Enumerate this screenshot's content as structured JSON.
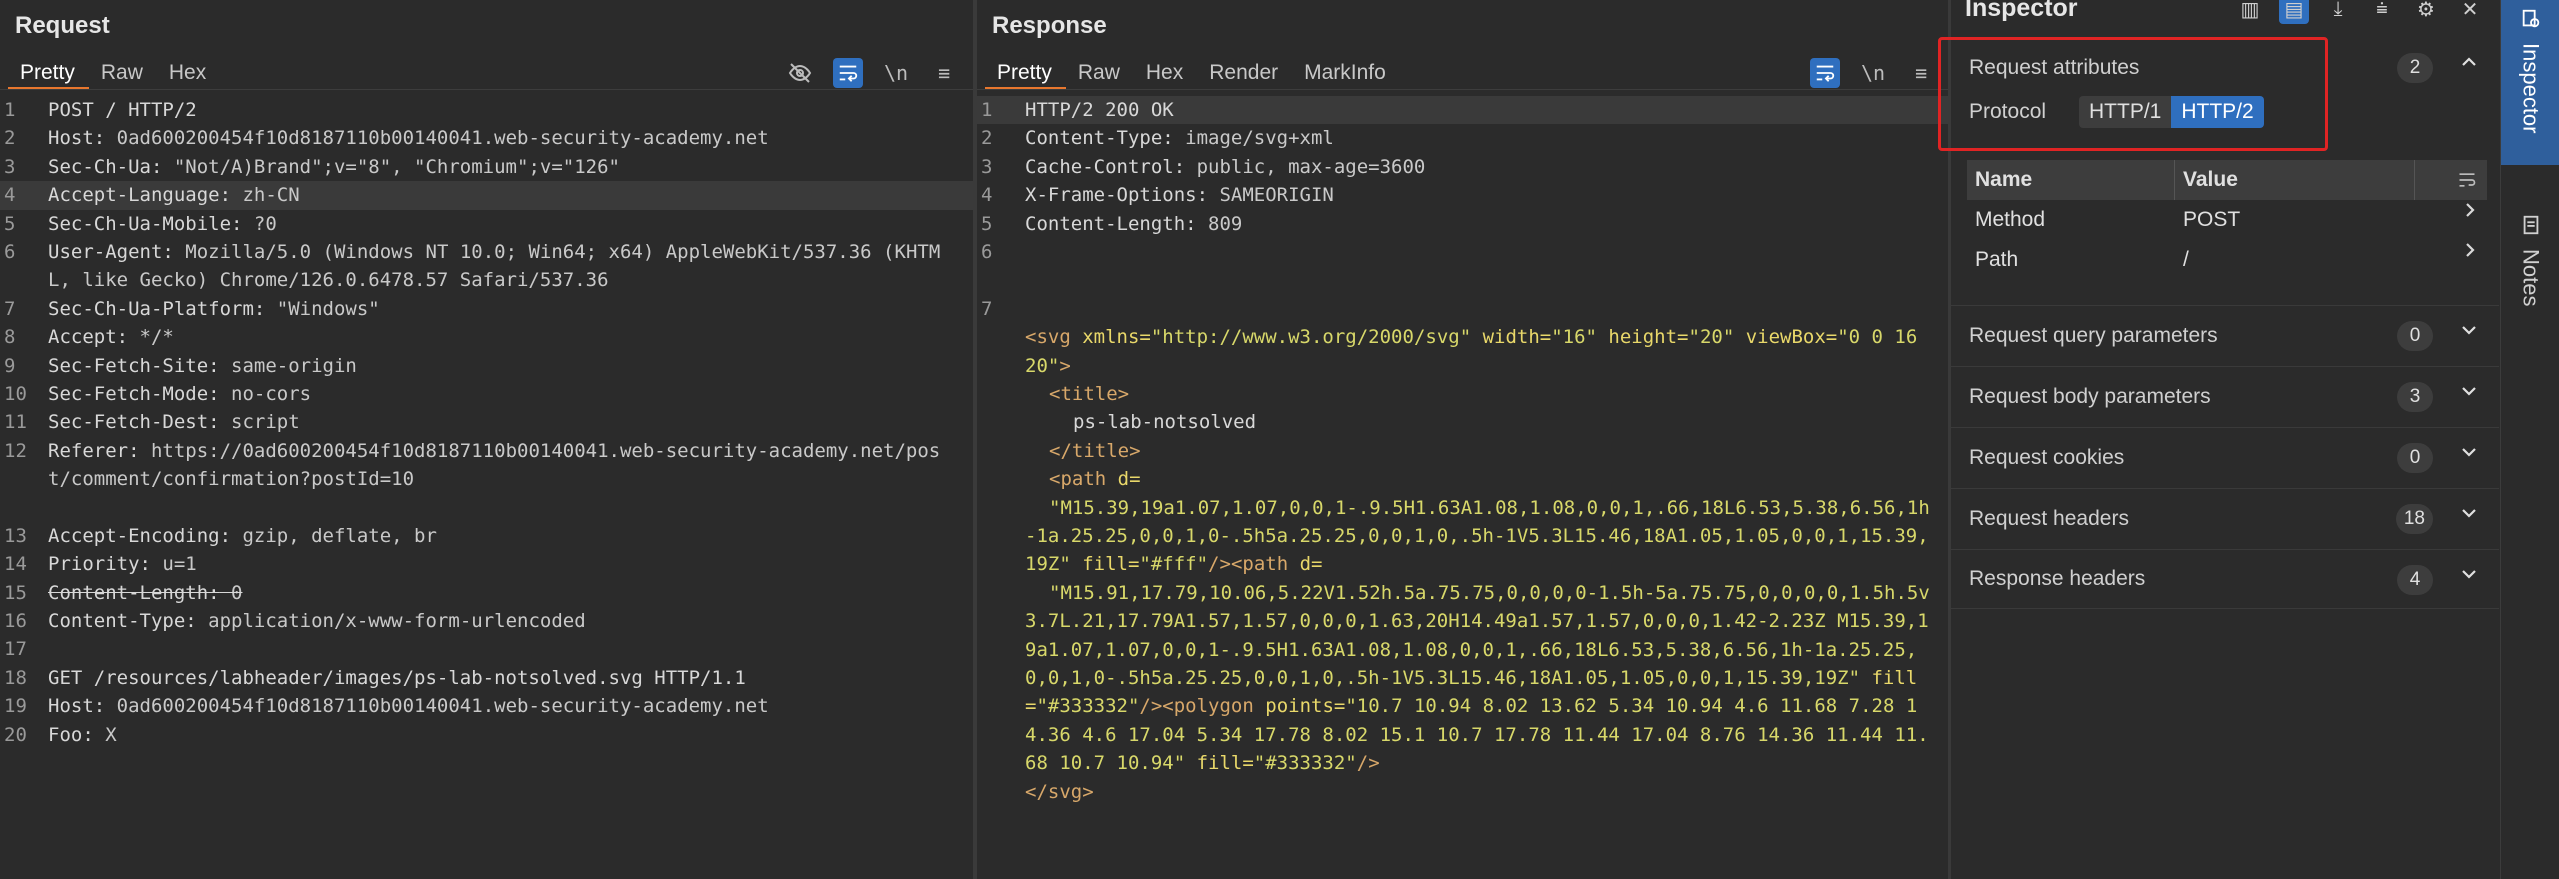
{
  "request": {
    "title": "Request",
    "tabs": [
      "Pretty",
      "Raw",
      "Hex"
    ],
    "active_tab": "Pretty",
    "tools": {
      "hide": "⊘",
      "wrap": "↵",
      "newline": "\\n",
      "menu": "≡"
    },
    "lines": [
      {
        "n": "1",
        "key": "POST / HTTP/2",
        "val": ""
      },
      {
        "n": "2",
        "key": "Host:",
        "val": " 0ad600200454f10d8187110b00140041.web-security-academy.net"
      },
      {
        "n": "3",
        "key": "Sec-Ch-Ua:",
        "val": " \"Not/A)Brand\";v=\"8\", \"Chromium\";v=\"126\""
      },
      {
        "n": "4",
        "key": "Accept-Language:",
        "val": " zh-CN"
      },
      {
        "n": "5",
        "key": "Sec-Ch-Ua-Mobile:",
        "val": " ?0"
      },
      {
        "n": "6",
        "key": "User-Agent:",
        "val": " Mozilla/5.0 (Windows NT 10.0; Win64; x64) AppleWebKit/537.36 (KHTML, like Gecko) Chrome/126.0.6478.57 Safari/537.36"
      },
      {
        "n": "7",
        "key": "Sec-Ch-Ua-Platform:",
        "val": " \"Windows\""
      },
      {
        "n": "8",
        "key": "Accept:",
        "val": " */*"
      },
      {
        "n": "9",
        "key": "Sec-Fetch-Site:",
        "val": " same-origin"
      },
      {
        "n": "10",
        "key": "Sec-Fetch-Mode:",
        "val": " no-cors"
      },
      {
        "n": "11",
        "key": "Sec-Fetch-Dest:",
        "val": " script"
      },
      {
        "n": "12",
        "key": "Referer:",
        "val": " https://0ad600200454f10d8187110b00140041.web-security-academy.net/post/comment/confirmation?postId=10"
      },
      {
        "n": "13",
        "key": "Accept-Encoding:",
        "val": " gzip, deflate, br"
      },
      {
        "n": "14",
        "key": "Priority:",
        "val": " u=1"
      },
      {
        "n": "15",
        "key": "Content-Length:",
        "val": " 0"
      },
      {
        "n": "16",
        "key": "Content-Type:",
        "val": " application/x-www-form-urlencoded"
      },
      {
        "n": "17",
        "key": "",
        "val": ""
      },
      {
        "n": "18",
        "key": "GET /resources/labheader/images/ps-lab-notsolved.svg HTTP/1.1",
        "val": ""
      },
      {
        "n": "19",
        "key": "Host:",
        "val": " 0ad600200454f10d8187110b00140041.web-security-academy.net"
      },
      {
        "n": "20",
        "key": "Foo:",
        "val": " X"
      }
    ]
  },
  "response": {
    "title": "Response",
    "tabs": [
      "Pretty",
      "Raw",
      "Hex",
      "Render",
      "MarkInfo"
    ],
    "active_tab": "Pretty",
    "tools": {
      "wrap": "↵",
      "newline": "\\n",
      "menu": "≡"
    },
    "header_lines": [
      {
        "n": "1",
        "text": "HTTP/2 200 OK"
      },
      {
        "n": "2",
        "key": "Content-Type:",
        "val": " image/svg+xml"
      },
      {
        "n": "3",
        "key": "Cache-Control:",
        "val": " public, max-age=3600"
      },
      {
        "n": "4",
        "key": "X-Frame-Options:",
        "val": " SAMEORIGIN"
      },
      {
        "n": "5",
        "key": "Content-Length:",
        "val": " 809"
      },
      {
        "n": "6",
        "text": ""
      }
    ],
    "body": {
      "n7": "7",
      "svg_open": "<svg",
      "xmlns_attr": " xmlns=",
      "xmlns_val": "\"http://www.w3.org/2000/svg\"",
      "width_attr": " width=",
      "width_val": "\"16\"",
      "height_attr": " height=",
      "height_val": "\"20\"",
      "viewbox_attr": " viewBox=",
      "viewbox_val": "\"0 0 16 20\"",
      "gt": ">",
      "title_open": "<title>",
      "title_text": "ps-lab-notsolved",
      "title_close": "</title>",
      "path1_open": "<path",
      "d_attr": " d=",
      "path1_d": "\"M15.39,19a1.07,1.07,0,0,1-.9.5H1.63A1.08,1.08,0,0,1,.66,18L6.53,5.38,6.56,1h-1a.25.25,0,0,1,0-.5h5a.25.25,0,0,1,0,.5h-1V5.3L15.46,18A1.05,1.05,0,0,1,15.39,19Z\"",
      "fill_attr": " fill=",
      "fill1_val": "\"#fff\"",
      "selfclose": "/>",
      "path2_open": "<path",
      "path2_d": "\"M15.91,17.79,10.06,5.22V1.52h.5a.75.75,0,0,0,0-1.5h-5a.75.75,0,0,0,0,1.5h.5v3.7L.21,17.79A1.57,1.57,0,0,0,1.63,20H14.49a1.57,1.57,0,0,0,1.42-2.23Z M15.39,19a1.07,1.07,0,0,1-.9.5H1.63A1.08,1.08,0,0,1,.66,18L6.53,5.38,6.56,1h-1a.25.25,0,0,1,0-.5h5a.25.25,0,0,1,0,.5h-1V5.3L15.46,18A1.05,1.05,0,0,1,15.39,19Z\"",
      "fill2_val": "\"#333332\"",
      "polygon_open": "<polygon",
      "points_attr": " points=",
      "points_val": "\"10.7 10.94 8.02 13.62 5.34 10.94 4.6 11.68 7.28 14.36 4.6 17.04 5.34 17.78 8.02 15.1 10.7 17.78 11.44 17.04 8.76 14.36 11.44 11.68 10.7 10.94\"",
      "fill3_val": "\"#333332\"",
      "svg_close": "</svg>"
    }
  },
  "inspector": {
    "title": "Inspector",
    "tools": [
      "▥",
      "▤",
      "⤓",
      "⩧",
      "⚙",
      "✕"
    ],
    "request_attributes": {
      "label": "Request attributes",
      "count": "2",
      "protocol_label": "Protocol",
      "protocols": [
        "HTTP/1",
        "HTTP/2"
      ],
      "selected": "HTTP/2",
      "table_headers": [
        "Name",
        "Value"
      ],
      "rows": [
        {
          "name": "Method",
          "value": "POST"
        },
        {
          "name": "Path",
          "value": "/"
        }
      ]
    },
    "sections": [
      {
        "label": "Request query parameters",
        "count": "0"
      },
      {
        "label": "Request body parameters",
        "count": "3"
      },
      {
        "label": "Request cookies",
        "count": "0"
      },
      {
        "label": "Request headers",
        "count": "18"
      },
      {
        "label": "Response headers",
        "count": "4"
      }
    ]
  },
  "rail": {
    "inspector": "Inspector",
    "notes": "Notes"
  },
  "colors": {
    "accent_orange": "#e8772e",
    "accent_blue": "#2f6fbf",
    "highlight_red": "#e02424"
  }
}
